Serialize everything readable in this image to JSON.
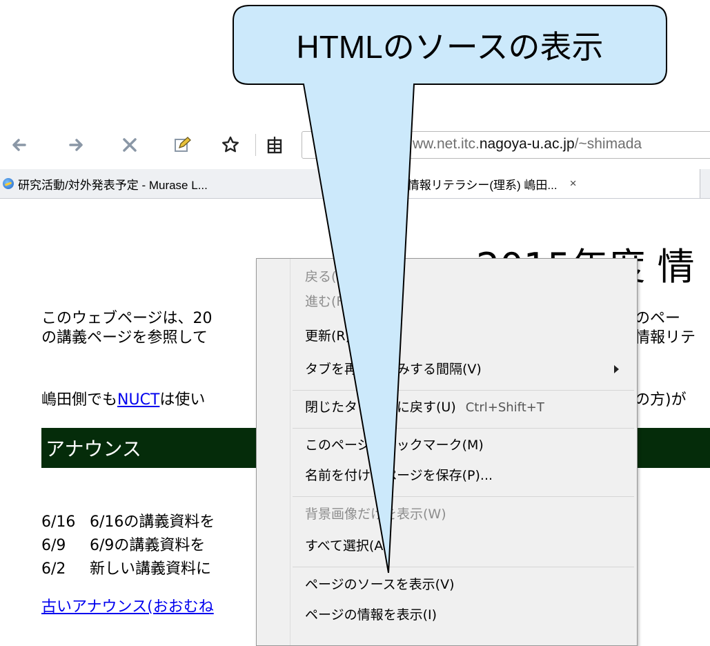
{
  "toolbar": {
    "url_prefix": "ww.net.itc.",
    "url_host": "nagoya-u.ac.jp",
    "url_suffix": "/~shimada"
  },
  "tabs": [
    {
      "label": "研究活動/対外発表予定 - Murase L..."
    },
    {
      "label": "年度 情報リテラシー(理系) 嶋田...",
      "close": "×"
    }
  ],
  "page": {
    "heading": "2015年度 情",
    "intro_left_1": "このウェブページは、20",
    "intro_left_2": "の講義ページを参照して",
    "intro_right_1": "のペー",
    "intro_right_2": "情報リテ",
    "nuct_prefix": "嶋田側でも",
    "nuct_link": "NUCT",
    "nuct_suffix": "は使い",
    "nuct_right": "の方)が",
    "announce_title": "アナウンス",
    "announcements": [
      {
        "date": "6/16",
        "text": "6/16の講義資料を"
      },
      {
        "date": "6/9",
        "text": "6/9の講義資料を"
      },
      {
        "date": "6/2",
        "text": "新しい講義資料に"
      }
    ],
    "old_announcements": "古いアナウンス(おおむね"
  },
  "context_menu": {
    "items": [
      {
        "label": "戻る(B)",
        "disabled": true
      },
      {
        "label": "進む(F)",
        "disabled": true
      },
      {
        "label": "更新(R)",
        "disabled": false
      },
      {
        "label": "タブを再読み込みする間隔(V)",
        "disabled": false
      },
      {
        "label": "閉じたタブを元に戻す(U)",
        "shortcut": "Ctrl+Shift+T",
        "disabled": false
      },
      {
        "label": "このページをブックマーク(M)",
        "disabled": false
      },
      {
        "label": "名前を付けてページを保存(P)...",
        "disabled": false
      },
      {
        "label": "背景画像だけを表示(W)",
        "disabled": true
      },
      {
        "label": "すべて選択(A)",
        "disabled": false
      },
      {
        "label": "ページのソースを表示(V)",
        "disabled": false
      },
      {
        "label": "ページの情報を表示(I)",
        "disabled": false
      }
    ]
  },
  "callout": {
    "text": "HTMLのソースの表示",
    "fill_color": "#cce9fb"
  }
}
